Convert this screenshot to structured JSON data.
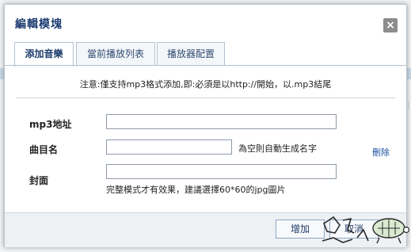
{
  "dialog": {
    "title": "編輯模塊",
    "close_icon": "close-icon"
  },
  "tabs": [
    {
      "label": "添加音樂",
      "active": true
    },
    {
      "label": "當前播放列表",
      "active": false
    },
    {
      "label": "播放器配置",
      "active": false
    }
  ],
  "notice": "注意:僅支持mp3格式添加,即:必須是以http://開始，以.mp3結尾",
  "form": {
    "mp3_label": "mp3地址",
    "mp3_value": "",
    "name_label": "曲目名",
    "name_value": "",
    "name_hint": "為空則自動生成名字",
    "cover_label": "封面",
    "cover_value": "",
    "cover_hint": "完整模式才有效果，建議選擇60*60的jpg圖片",
    "delete_label": "刪除"
  },
  "footer": {
    "add_label": "增加",
    "cancel_label": "取消"
  },
  "background": {
    "left_glyph": "己",
    "right_glyph": "暄",
    "right_char": "如"
  },
  "colors": {
    "title": "#1f3d72",
    "link": "#1a4fa0",
    "close_bg": "#8c8c8c"
  }
}
